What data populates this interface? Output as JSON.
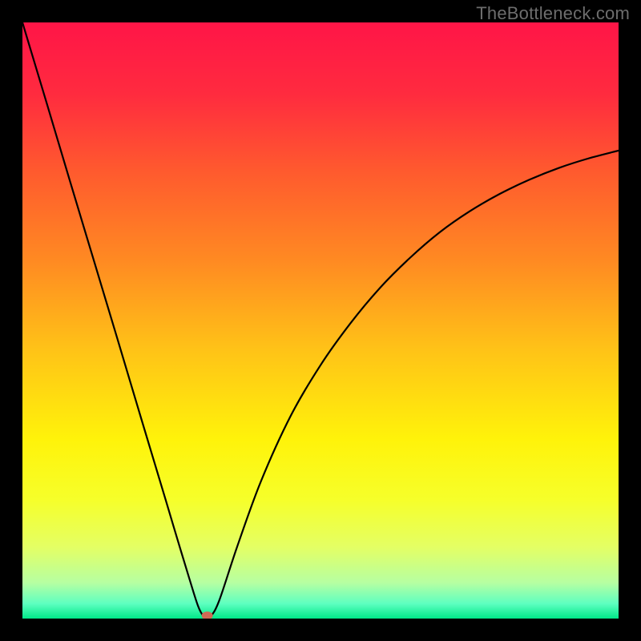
{
  "watermark": "TheBottleneck.com",
  "chart_data": {
    "type": "line",
    "title": "",
    "xlabel": "",
    "ylabel": "",
    "xlim": [
      0,
      100
    ],
    "ylim": [
      0,
      100
    ],
    "grid": false,
    "legend": null,
    "background_gradient": {
      "stops": [
        {
          "pos": 0.0,
          "color": "#ff1547"
        },
        {
          "pos": 0.12,
          "color": "#ff2b3f"
        },
        {
          "pos": 0.25,
          "color": "#ff5a2e"
        },
        {
          "pos": 0.4,
          "color": "#ff8a22"
        },
        {
          "pos": 0.55,
          "color": "#ffc317"
        },
        {
          "pos": 0.7,
          "color": "#fff30a"
        },
        {
          "pos": 0.8,
          "color": "#f6ff2a"
        },
        {
          "pos": 0.88,
          "color": "#e4ff64"
        },
        {
          "pos": 0.94,
          "color": "#b6ffa2"
        },
        {
          "pos": 0.975,
          "color": "#5effc0"
        },
        {
          "pos": 1.0,
          "color": "#00e888"
        }
      ]
    },
    "series": [
      {
        "name": "bottleneck-curve",
        "color": "#000000",
        "x": [
          0.0,
          4.0,
          8.0,
          12.0,
          16.0,
          20.0,
          24.0,
          26.0,
          28.0,
          29.5,
          30.5,
          31.5,
          33.0,
          36.0,
          40.0,
          45.0,
          50.0,
          55.0,
          60.0,
          65.0,
          70.0,
          75.0,
          80.0,
          85.0,
          90.0,
          95.0,
          100.0
        ],
        "y": [
          100.0,
          86.7,
          73.3,
          60.0,
          46.7,
          33.3,
          20.0,
          13.3,
          6.7,
          2.0,
          0.3,
          0.3,
          3.0,
          12.0,
          23.0,
          34.0,
          42.5,
          49.5,
          55.5,
          60.5,
          64.8,
          68.3,
          71.2,
          73.6,
          75.6,
          77.2,
          78.5
        ]
      }
    ],
    "marker": {
      "name": "current-point",
      "x": 31.0,
      "y": 0.5,
      "color": "#cf6a55",
      "rx": 7,
      "ry": 5
    }
  }
}
